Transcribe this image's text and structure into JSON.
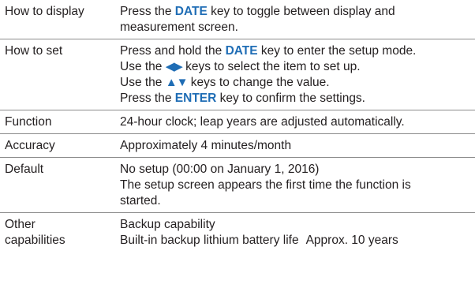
{
  "rows": [
    {
      "label": "How to display",
      "lines": [
        {
          "pre": "Press the ",
          "key": "DATE",
          "post": " key to toggle between display and"
        },
        {
          "text": "measurement screen."
        }
      ]
    },
    {
      "label": "How to set",
      "lines": [
        {
          "pre": "Press and hold the ",
          "key": "DATE",
          "post": " key to enter the setup mode."
        },
        {
          "pre": "Use the ",
          "arrows": "◀▶",
          "arrows_icon": "left-right-arrow-keys-icon",
          "post": " keys to select the item to set up."
        },
        {
          "pre": "Use the ",
          "arrows": "▲▼",
          "arrows_icon": "up-down-arrow-keys-icon",
          "post": " keys to change the value."
        },
        {
          "pre": "Press the ",
          "key": "ENTER",
          "post": " key to confirm the settings."
        }
      ]
    },
    {
      "label": "Function",
      "text": "24-hour clock; leap years are adjusted automatically."
    },
    {
      "label": "Accuracy",
      "text": "Approximately 4 minutes/month"
    },
    {
      "label": "Default",
      "lines": [
        {
          "text": "No setup (00:00 on January 1, 2016)"
        },
        {
          "text": "The setup screen appears the first time the function is"
        },
        {
          "text": "started."
        }
      ]
    },
    {
      "label_lines": [
        "Other",
        "capabilities"
      ],
      "lines": [
        {
          "text": "Backup capability"
        },
        {
          "text": "Built-in backup lithium battery life",
          "extra": "Approx. 10 years"
        }
      ]
    }
  ],
  "colors": {
    "keyword": "#1f6db5",
    "rule": "#8c8c8c",
    "text": "#231f20"
  }
}
